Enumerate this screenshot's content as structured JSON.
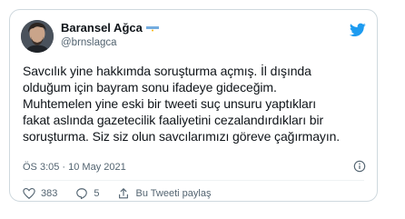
{
  "author": {
    "display_name": "Baransel Ağca",
    "handle": "@brnslagca",
    "flag_icon": "argentina-flag-icon",
    "avatar_icon": "avatar"
  },
  "platform_icon": "twitter-bird-icon",
  "tweet": {
    "lines": [
      "Savcılık yine hakkımda soruşturma açmış. İl dışında",
      "olduğum için bayram sonu ifadeye gideceğim.",
      "Muhtemelen yine eski bir tweeti suç unsuru yaptıkları",
      "fakat aslında gazetecilik faaliyetini cezalandırdıkları bir",
      "soruşturma. Siz siz olun savcılarımızı göreve çağırmayın."
    ],
    "timestamp": "ÖS 3:05 · 10 May 2021"
  },
  "actions": {
    "like_count": "383",
    "reply_count": "5",
    "share_label": "Bu Tweeti paylaş"
  },
  "colors": {
    "twitter_blue": "#1d9bf0",
    "like_red": "#f91880",
    "muted": "#536471",
    "border": "#cfd9de"
  }
}
